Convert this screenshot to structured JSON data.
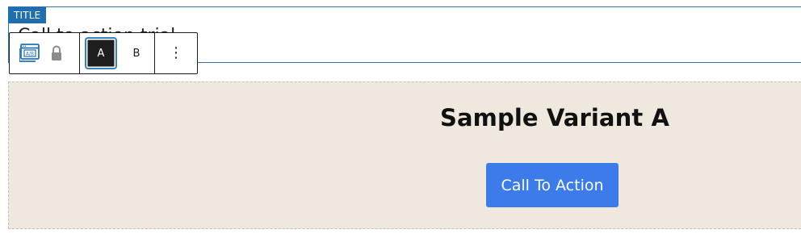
{
  "title_field": {
    "tag_label": "TITLE",
    "value": "Call to action trial"
  },
  "toolbar": {
    "block_icon": "ab-test-block-icon",
    "lock_icon": "lock-icon",
    "variants": [
      {
        "label": "A",
        "selected": true
      },
      {
        "label": "B",
        "selected": false
      }
    ],
    "more_label": "⋮"
  },
  "content": {
    "heading": "Sample Variant A",
    "cta_label": "Call To Action"
  },
  "colors": {
    "content_bg": "#efe8de",
    "cta_bg": "#3b7bea",
    "title_tag_bg": "#1f6fb0",
    "border_accent": "#3572a5"
  }
}
